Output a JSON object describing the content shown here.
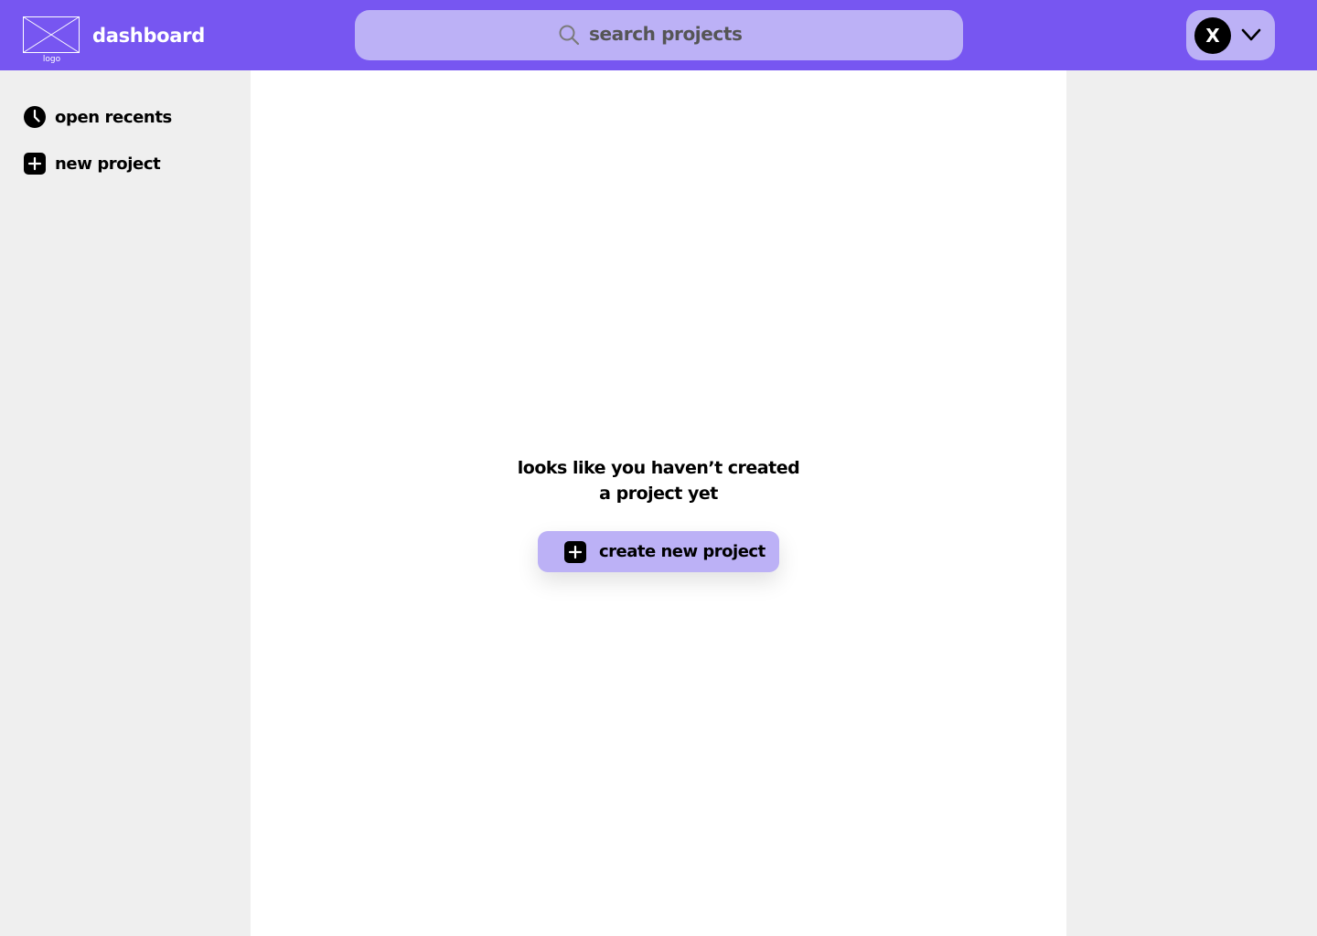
{
  "header": {
    "logo_caption": "logo",
    "title": "dashboard",
    "search": {
      "placeholder": "search projects",
      "icon": "search-icon"
    },
    "account": {
      "avatar_initial": "X",
      "menu_icon": "chevron-down-icon"
    }
  },
  "sidebar": {
    "items": [
      {
        "label": "open recents",
        "icon": "clock-icon"
      },
      {
        "label": "new project",
        "icon": "plus-square-icon"
      }
    ]
  },
  "main": {
    "empty_state": {
      "message_line1": "looks like you haven’t created",
      "message_line2": "a project yet",
      "button_label": "create new project",
      "button_icon": "plus-square-icon"
    }
  },
  "colors": {
    "header_bg": "#7756f1",
    "accent_light": "#bcb1f6",
    "sidebar_bg": "#efefef",
    "main_bg": "#ffffff"
  }
}
